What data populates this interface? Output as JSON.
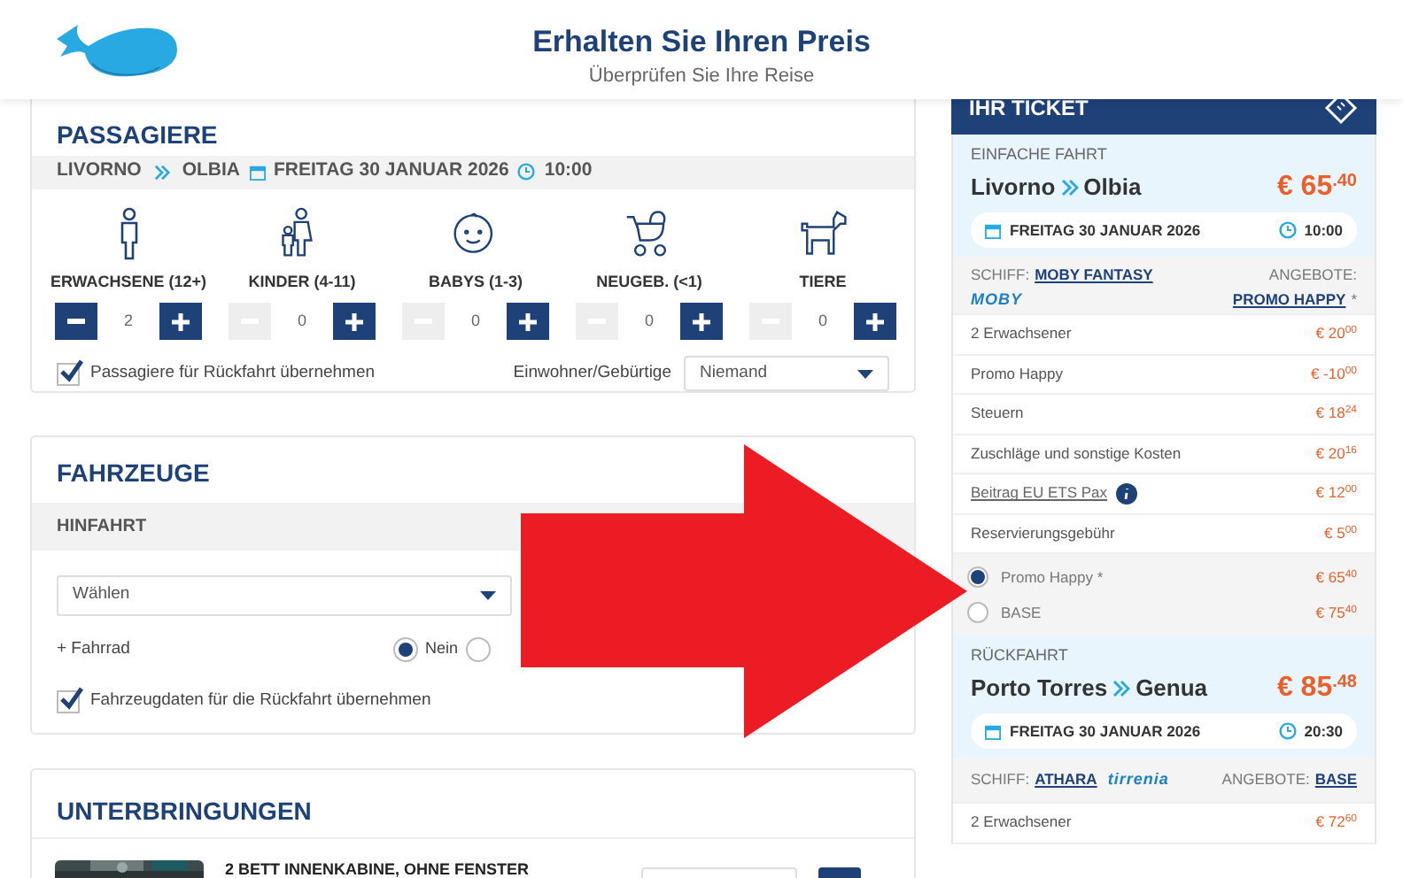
{
  "header": {
    "title": "Erhalten Sie Ihren Preis",
    "subtitle": "Überprüfen Sie Ihre Reise"
  },
  "passengers": {
    "title": "PASSAGIERE",
    "route": {
      "from": "LIVORNO",
      "to": "OLBIA",
      "date": "FREITAG 30 JANUAR 2026",
      "time": "10:00"
    },
    "categories": [
      {
        "kind": "adult",
        "label": "ERWACHSENE (12+)",
        "value": "2",
        "minus_disabled": false
      },
      {
        "kind": "child",
        "label": "KINDER (4-11)",
        "value": "0",
        "minus_disabled": true
      },
      {
        "kind": "baby",
        "label": "BABYS (1-3)",
        "value": "0",
        "minus_disabled": true
      },
      {
        "kind": "newborn",
        "label": "NEUGEB. (<1)",
        "value": "0",
        "minus_disabled": true
      },
      {
        "kind": "pet",
        "label": "TIERE",
        "value": "0",
        "minus_disabled": true
      }
    ],
    "copy_return": {
      "label": "Passagiere für Rückfahrt übernehmen",
      "checked": true
    },
    "residents": {
      "label": "Einwohner/Gebürtige",
      "value": "Niemand"
    }
  },
  "vehicles": {
    "title": "FAHRZEUGE",
    "direction": "HINFAHRT",
    "select": {
      "value": "Wählen"
    },
    "bike": "+ Fahrrad",
    "bike_options": [
      {
        "label": "Nein",
        "selected": true
      },
      {
        "selected": false
      }
    ],
    "copy_return": {
      "label": "Fahrzeugdaten für die Rückfahrt übernehmen",
      "checked": true
    }
  },
  "accommodations": {
    "title": "UNTERBRINGUNGEN",
    "items": [
      {
        "name": "2 BETT INNENKABINE, OHNE FENSTER"
      }
    ]
  },
  "ticket": {
    "title": "IHR TICKET",
    "legs": [
      {
        "label": "EINFACHE FAHRT",
        "from": "Livorno",
        "to": "Olbia",
        "price": "€ 65$^{.40}$",
        "date": "FREITAG 30 JANUAR 2026",
        "time": "10:00",
        "ship": {
          "kind": "two_line",
          "label": "SCHIFF:",
          "name": "MOBY FANTASY",
          "logo": "MOBY",
          "offers_label": "ANGEBOTE:",
          "offer": "PROMO HAPPY",
          "offer_note": "*"
        },
        "lines": [
          {
            "kind": "plain",
            "label": "2 Erwachsener",
            "amount": "€ 20$^{00}$"
          },
          {
            "kind": "plain",
            "label": "Promo Happy",
            "amount": "€ -10$^{00}$"
          },
          {
            "kind": "plain",
            "label": "Steuern",
            "amount": "€ 18$^{24}$"
          },
          {
            "kind": "plain",
            "label": "Zuschläge und sonstige Kosten",
            "amount": "€ 20$^{16}$"
          },
          {
            "kind": "info",
            "label": "Beitrag EU ETS Pax",
            "amount": "€ 12$^{00}$"
          },
          {
            "kind": "plain",
            "label": "Reservierungsgebühr",
            "amount": "€ 5$^{00}$"
          }
        ],
        "fares": [
          {
            "label": "Promo Happy *",
            "amount": "€ 65$^{40}$",
            "selected": true
          },
          {
            "label": "BASE",
            "amount": "€ 75$^{40}$",
            "selected": false
          }
        ]
      },
      {
        "label": "RÜCKFAHRT",
        "from": "Porto Torres",
        "to": "Genua",
        "price": "€ 85$^{.48}$",
        "date": "FREITAG 30 JANUAR 2026",
        "time": "20:30",
        "ship": {
          "kind": "one_line",
          "label": "SCHIFF:",
          "name": "ATHARA",
          "logo": "tirrenia",
          "offers_label": "ANGEBOTE:",
          "offer": "BASE"
        },
        "lines": [
          {
            "kind": "plain",
            "label": "2 Erwachsener",
            "amount": "€ 72$^{60}$"
          }
        ]
      }
    ]
  }
}
